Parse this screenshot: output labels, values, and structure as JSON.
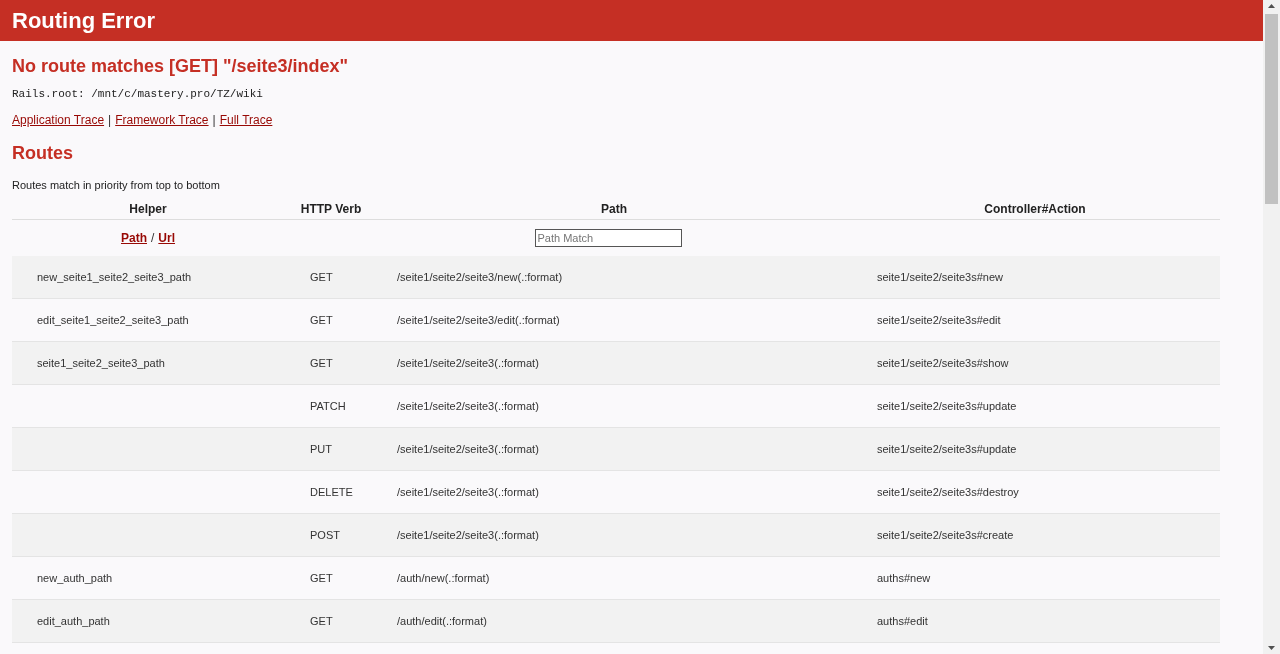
{
  "header": {
    "title": "Routing Error"
  },
  "error_message": "No route matches [GET] \"/seite3/index\"",
  "rails_root": "Rails.root: /mnt/c/mastery.pro/TZ/wiki",
  "trace_links": [
    {
      "kind": "link",
      "text": "Application Trace"
    },
    {
      "kind": "separator",
      "text": "|"
    },
    {
      "kind": "link",
      "text": "Framework Trace"
    },
    {
      "kind": "separator",
      "text": "|"
    },
    {
      "kind": "link",
      "text": "Full Trace"
    }
  ],
  "routes": {
    "title": "Routes",
    "description": "Routes match in priority from top to bottom",
    "columns": [
      "Helper",
      "HTTP Verb",
      "Path",
      "Controller#Action"
    ],
    "helper_toggle": {
      "path": "Path",
      "separator": "/",
      "url": "Url"
    },
    "filter": {
      "placeholder": "Path Match"
    },
    "rows": [
      {
        "helper": "new_seite1_seite2_seite3_path",
        "verb": "GET",
        "path": "/seite1/seite2/seite3/new(.:format)",
        "action": "seite1/seite2/seite3s#new"
      },
      {
        "helper": "edit_seite1_seite2_seite3_path",
        "verb": "GET",
        "path": "/seite1/seite2/seite3/edit(.:format)",
        "action": "seite1/seite2/seite3s#edit"
      },
      {
        "helper": "seite1_seite2_seite3_path",
        "verb": "GET",
        "path": "/seite1/seite2/seite3(.:format)",
        "action": "seite1/seite2/seite3s#show"
      },
      {
        "helper": "",
        "verb": "PATCH",
        "path": "/seite1/seite2/seite3(.:format)",
        "action": "seite1/seite2/seite3s#update"
      },
      {
        "helper": "",
        "verb": "PUT",
        "path": "/seite1/seite2/seite3(.:format)",
        "action": "seite1/seite2/seite3s#update"
      },
      {
        "helper": "",
        "verb": "DELETE",
        "path": "/seite1/seite2/seite3(.:format)",
        "action": "seite1/seite2/seite3s#destroy"
      },
      {
        "helper": "",
        "verb": "POST",
        "path": "/seite1/seite2/seite3(.:format)",
        "action": "seite1/seite2/seite3s#create"
      },
      {
        "helper": "new_auth_path",
        "verb": "GET",
        "path": "/auth/new(.:format)",
        "action": "auths#new"
      },
      {
        "helper": "edit_auth_path",
        "verb": "GET",
        "path": "/auth/edit(.:format)",
        "action": "auths#edit"
      }
    ]
  }
}
